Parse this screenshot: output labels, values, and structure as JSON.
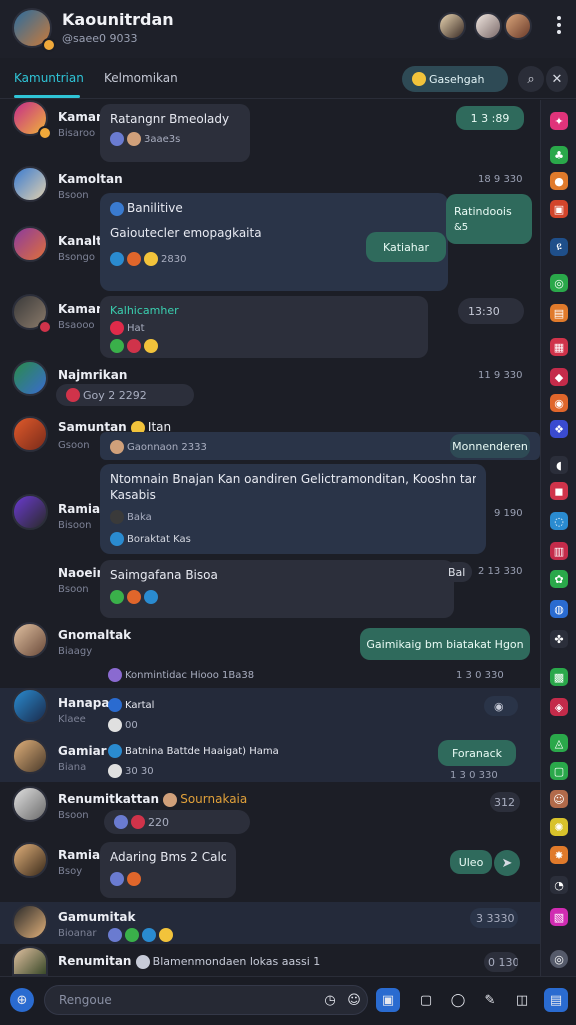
{
  "header": {
    "title": "Kaounitrdan",
    "subtitle": "@saee0 9033"
  },
  "tabs": [
    {
      "label": "Kamuntrian"
    },
    {
      "label": "Kelmomikan"
    }
  ],
  "toolbar": {
    "action_label": "Gasehgah"
  },
  "messages": [
    {
      "name": "Kaman",
      "sub": "Bisaroo",
      "text": "Ratangnr Bmeolady",
      "meta": "3aae3s",
      "right_label": "1 3 :89"
    },
    {
      "name": "Kamoltan",
      "sub": "Bsoon",
      "time": "18 9 330"
    },
    {
      "name": "Kanalt",
      "sub": "Bsongo",
      "line1": "Banilitive",
      "line2": "Gaioutecler emopagkaita",
      "meta": "2830",
      "right_label": "Ratindoois",
      "right_meta": "&5",
      "pill": "Katiahar"
    },
    {
      "name": "Kaman",
      "sub": "Bsaooo",
      "line1": "Kalhicamher",
      "line2": "Hat",
      "time": "13:30"
    },
    {
      "name": "Najmrikan",
      "sub": "",
      "meta": "Goy 2 2292",
      "time": "11 9 330"
    },
    {
      "name": "Samuntan",
      "sub": "Gsoon",
      "suffix": "Itan",
      "inline": "Gaonnaon 2333",
      "pill": "Monnenderen"
    },
    {
      "name": "Ramia",
      "sub": "Bisoon",
      "text": "Ntomnain Bnajan Kan oandiren Gelictramonditan, Kooshn tandaka",
      "text2": "Kasabis",
      "meta": "Baka",
      "meta2": "Boraktat Kas",
      "time": "9 190"
    },
    {
      "name": "Naoein",
      "sub": "Bsoon",
      "text": "Saimgafana Bisoa",
      "time": "2 13 330",
      "badge": "Bal"
    },
    {
      "name": "Gnomaltak",
      "sub": "Biaagy",
      "meta": "Konmintidac Hiooo 1Ba38",
      "pill": "Gaimikaig bm biatakat Hgon",
      "time": "1 3 0 330"
    },
    {
      "name": "Hanapa",
      "sub": "Klaee",
      "line1": "Kartal",
      "meta": "00"
    },
    {
      "name": "Gamiar",
      "sub": "Biana",
      "line1": "Batnina Battde Haaigat) Hama",
      "meta": "30 30",
      "pill": "Foranack",
      "time": "1 3 0 330"
    },
    {
      "name": "Renumitkattan",
      "sub": "Bsoon",
      "inline": "Sournakaia",
      "meta": "220",
      "time": "312"
    },
    {
      "name": "Ramian",
      "sub": "Bsoy",
      "text": "Adaring Bms 2 Calo?",
      "pill": "Uleo"
    },
    {
      "name": "Gamumitak",
      "sub": "Bioanar",
      "time": "3 3330"
    },
    {
      "name": "Renumitan",
      "inline": "Blamenmondaen lokas aassi 1",
      "time": "0 130"
    }
  ],
  "composer": {
    "placeholder": "Rengoue"
  },
  "colors": {
    "accent": "#2fc4d6",
    "green_pill": "#2f6a5c",
    "bubble": "#2c2f3b",
    "background": "#1c1e26"
  },
  "icons": [
    "search-icon",
    "kebab-icon",
    "emoji-icon",
    "send-icon",
    "attach-icon",
    "sticker-icon",
    "camera-icon",
    "mic-icon"
  ]
}
